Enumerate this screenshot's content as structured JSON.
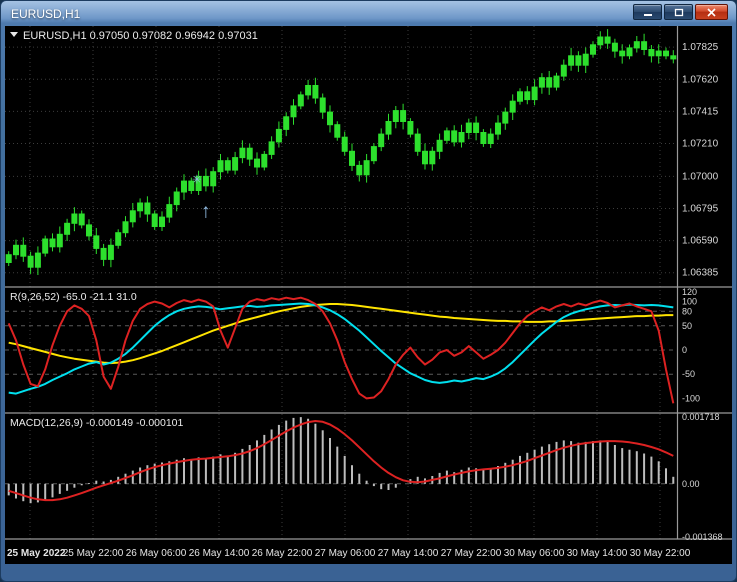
{
  "window": {
    "title": "EURUSD,H1",
    "controls": [
      {
        "name": "minimize"
      },
      {
        "name": "restore"
      },
      {
        "name": "close"
      }
    ]
  },
  "colors": {
    "background": "#000000",
    "grid": "#3d3d3d",
    "level_line": "#5a5a5a",
    "separator": "#9a9a9a",
    "candle": "#2de02d",
    "axis_text": "#d8d8d8",
    "label_text": "#ececec",
    "time_text": "#e6e6e6",
    "marker": "#8fb8de"
  },
  "chart_data": [
    {
      "type": "candlestick",
      "title": "EURUSD,H1",
      "dropdown_icon": "▼",
      "ohlc_label": "0.97050 0.97082 0.96942 0.97031",
      "y_ticks": [
        "1.07825",
        "1.07620",
        "1.07415",
        "1.07210",
        "1.07000",
        "1.06795",
        "1.06590",
        "1.06385"
      ],
      "ylim": [
        1.063,
        1.0796
      ],
      "x_labels": [
        "25 May 2022",
        "25 May 22:00",
        "26 May 06:00",
        "26 May 14:00",
        "26 May 22:00",
        "27 May 06:00",
        "27 May 14:00",
        "27 May 22:00",
        "30 May 06:00",
        "30 May 14:00",
        "30 May 22:00"
      ],
      "close": [
        1.065,
        1.0656,
        1.0649,
        1.0642,
        1.0651,
        1.066,
        1.0655,
        1.0663,
        1.067,
        1.0676,
        1.0669,
        1.0662,
        1.0654,
        1.0647,
        1.0656,
        1.0664,
        1.0671,
        1.0678,
        1.0683,
        1.0676,
        1.0668,
        1.0674,
        1.0682,
        1.069,
        1.0697,
        1.0691,
        1.07,
        1.0694,
        1.0703,
        1.071,
        1.0704,
        1.0712,
        1.0718,
        1.0711,
        1.0706,
        1.0714,
        1.0722,
        1.073,
        1.0738,
        1.0745,
        1.0752,
        1.0758,
        1.075,
        1.0741,
        1.0733,
        1.0725,
        1.0716,
        1.0707,
        1.0701,
        1.071,
        1.0719,
        1.0727,
        1.0735,
        1.0742,
        1.0735,
        1.0727,
        1.0716,
        1.0708,
        1.0716,
        1.0723,
        1.0729,
        1.0722,
        1.0728,
        1.0734,
        1.0728,
        1.0721,
        1.0727,
        1.0734,
        1.0741,
        1.0748,
        1.0754,
        1.0749,
        1.0757,
        1.0763,
        1.0757,
        1.0764,
        1.0771,
        1.0777,
        1.0771,
        1.0778,
        1.0784,
        1.0789,
        1.0785,
        1.078,
        1.0777,
        1.0782,
        1.0786,
        1.0781,
        1.0777,
        1.078,
        1.0777,
        1.0775
      ],
      "marker": {
        "type": "buy-arrow-with-star",
        "bar": 27,
        "star_glyph": "✳",
        "arrow_glyph": "↑"
      }
    },
    {
      "type": "line",
      "title": "R(9,26,52)",
      "values_label": "-65.0 -21.1 31.0",
      "y_ticks": [
        120,
        100,
        80,
        50,
        0,
        -50,
        -100
      ],
      "levels": [
        80,
        50,
        0,
        -50
      ],
      "ylim": [
        -128,
        128
      ],
      "series": [
        {
          "name": "slow",
          "color": "#ffe400",
          "values": [
            15,
            12,
            8,
            4,
            0,
            -4,
            -8,
            -12,
            -15,
            -18,
            -20,
            -22,
            -24,
            -26,
            -27,
            -26,
            -24,
            -21,
            -17,
            -12,
            -7,
            -2,
            4,
            10,
            16,
            22,
            28,
            34,
            40,
            45,
            50,
            55,
            60,
            64,
            68,
            72,
            76,
            80,
            83,
            86,
            89,
            91,
            93,
            94,
            95,
            95,
            94,
            93,
            91,
            89,
            87,
            85,
            83,
            81,
            79,
            77,
            75,
            73,
            71,
            69,
            68,
            66,
            65,
            64,
            63,
            62,
            61,
            60,
            60,
            59,
            59,
            58,
            58,
            58,
            59,
            59,
            60,
            61,
            62,
            63,
            64,
            65,
            66,
            67,
            68,
            69,
            70,
            70,
            71,
            71,
            72,
            72
          ]
        },
        {
          "name": "medium",
          "color": "#00e0ee",
          "values": [
            -88,
            -90,
            -85,
            -80,
            -76,
            -70,
            -62,
            -55,
            -48,
            -40,
            -34,
            -28,
            -25,
            -30,
            -26,
            -18,
            -8,
            5,
            20,
            35,
            50,
            62,
            72,
            80,
            85,
            88,
            90,
            89,
            87,
            84,
            86,
            88,
            90,
            91,
            89,
            90,
            92,
            93,
            94,
            95,
            96,
            95,
            92,
            88,
            82,
            74,
            64,
            52,
            40,
            26,
            12,
            -2,
            -15,
            -28,
            -38,
            -48,
            -55,
            -62,
            -66,
            -68,
            -66,
            -63,
            -65,
            -62,
            -58,
            -60,
            -55,
            -48,
            -38,
            -25,
            -10,
            5,
            20,
            34,
            46,
            58,
            68,
            75,
            80,
            84,
            87,
            90,
            92,
            93,
            92,
            94,
            93,
            92,
            93,
            92,
            90,
            88
          ]
        },
        {
          "name": "fast",
          "color": "#dd2222",
          "values": [
            55,
            20,
            -30,
            -70,
            -75,
            -40,
            10,
            50,
            80,
            92,
            85,
            70,
            20,
            -55,
            -80,
            -35,
            20,
            60,
            85,
            95,
            100,
            96,
            88,
            97,
            103,
            99,
            104,
            100,
            90,
            40,
            5,
            45,
            85,
            100,
            105,
            102,
            107,
            104,
            108,
            105,
            108,
            103,
            95,
            80,
            55,
            20,
            -25,
            -60,
            -90,
            -100,
            -98,
            -85,
            -60,
            -30,
            -10,
            5,
            -15,
            -30,
            -20,
            -5,
            0,
            -12,
            -5,
            8,
            -5,
            -18,
            -10,
            0,
            15,
            35,
            55,
            70,
            80,
            88,
            82,
            90,
            95,
            90,
            96,
            92,
            98,
            102,
            97,
            88,
            92,
            96,
            90,
            85,
            80,
            40,
            -40,
            -110
          ]
        }
      ]
    },
    {
      "type": "macd",
      "title": "MACD(12,26,9)",
      "values_label": "-0.000149 -0.000101",
      "y_ticks": [
        "0.001718",
        "0.00",
        "-0.001368"
      ],
      "ylim": [
        -0.00145,
        0.0018
      ],
      "histogram_color": "#bdbdbd",
      "signal_color": "#dd2222",
      "histogram": [
        -0.0003,
        -0.00038,
        -0.00045,
        -0.0005,
        -0.00048,
        -0.00042,
        -0.00035,
        -0.00026,
        -0.00018,
        -0.0001,
        -4e-05,
        2e-05,
        8e-05,
        6e-05,
        0.0001,
        0.00018,
        0.00026,
        0.00034,
        0.00042,
        0.00048,
        0.00052,
        0.00055,
        0.00058,
        0.00062,
        0.00066,
        0.00063,
        0.00068,
        0.00064,
        0.0007,
        0.00076,
        0.00072,
        0.0008,
        0.0009,
        0.001,
        0.00112,
        0.00126,
        0.0014,
        0.00152,
        0.00163,
        0.0017,
        0.00172,
        0.00168,
        0.00155,
        0.00138,
        0.00118,
        0.00096,
        0.00072,
        0.00048,
        0.00026,
        8e-05,
        -6e-05,
        -0.00014,
        -0.00016,
        -0.0001,
        0.0,
        0.00012,
        0.00018,
        0.00014,
        0.0002,
        0.00028,
        0.00034,
        0.0003,
        0.00036,
        0.00042,
        0.0004,
        0.00036,
        0.0004,
        0.00046,
        0.00054,
        0.00062,
        0.00072,
        0.0008,
        0.00088,
        0.00096,
        0.00102,
        0.00108,
        0.00112,
        0.0011,
        0.00106,
        0.00108,
        0.0011,
        0.00112,
        0.00108,
        0.001,
        0.00092,
        0.00088,
        0.00084,
        0.00078,
        0.0007,
        0.00058,
        0.0004,
        0.00018
      ],
      "signal": [
        -0.00018,
        -0.00024,
        -0.0003,
        -0.00036,
        -0.0004,
        -0.00042,
        -0.00042,
        -0.0004,
        -0.00036,
        -0.0003,
        -0.00024,
        -0.00017,
        -0.0001,
        -4e-05,
        2e-05,
        8e-05,
        0.00015,
        0.00022,
        0.0003,
        0.00037,
        0.00043,
        0.00048,
        0.00052,
        0.00056,
        0.00059,
        0.00062,
        0.00064,
        0.00065,
        0.00067,
        0.00069,
        0.00071,
        0.00074,
        0.00078,
        0.00084,
        0.00092,
        0.00102,
        0.00113,
        0.00124,
        0.00135,
        0.00145,
        0.00153,
        0.00159,
        0.00162,
        0.0016,
        0.00153,
        0.00142,
        0.00128,
        0.00112,
        0.00094,
        0.00076,
        0.00058,
        0.00042,
        0.00028,
        0.00017,
        9e-05,
        5e-05,
        4e-05,
        6e-05,
        0.0001,
        0.00014,
        0.00019,
        0.00024,
        0.00028,
        0.00032,
        0.00035,
        0.00037,
        0.00039,
        0.00041,
        0.00044,
        0.00048,
        0.00053,
        0.00059,
        0.00066,
        0.00073,
        0.0008,
        0.00087,
        0.00093,
        0.00098,
        0.00102,
        0.00105,
        0.00107,
        0.00109,
        0.0011,
        0.0011,
        0.00109,
        0.00107,
        0.00104,
        0.001,
        0.00095,
        0.00089,
        0.00081,
        0.00072
      ]
    }
  ]
}
